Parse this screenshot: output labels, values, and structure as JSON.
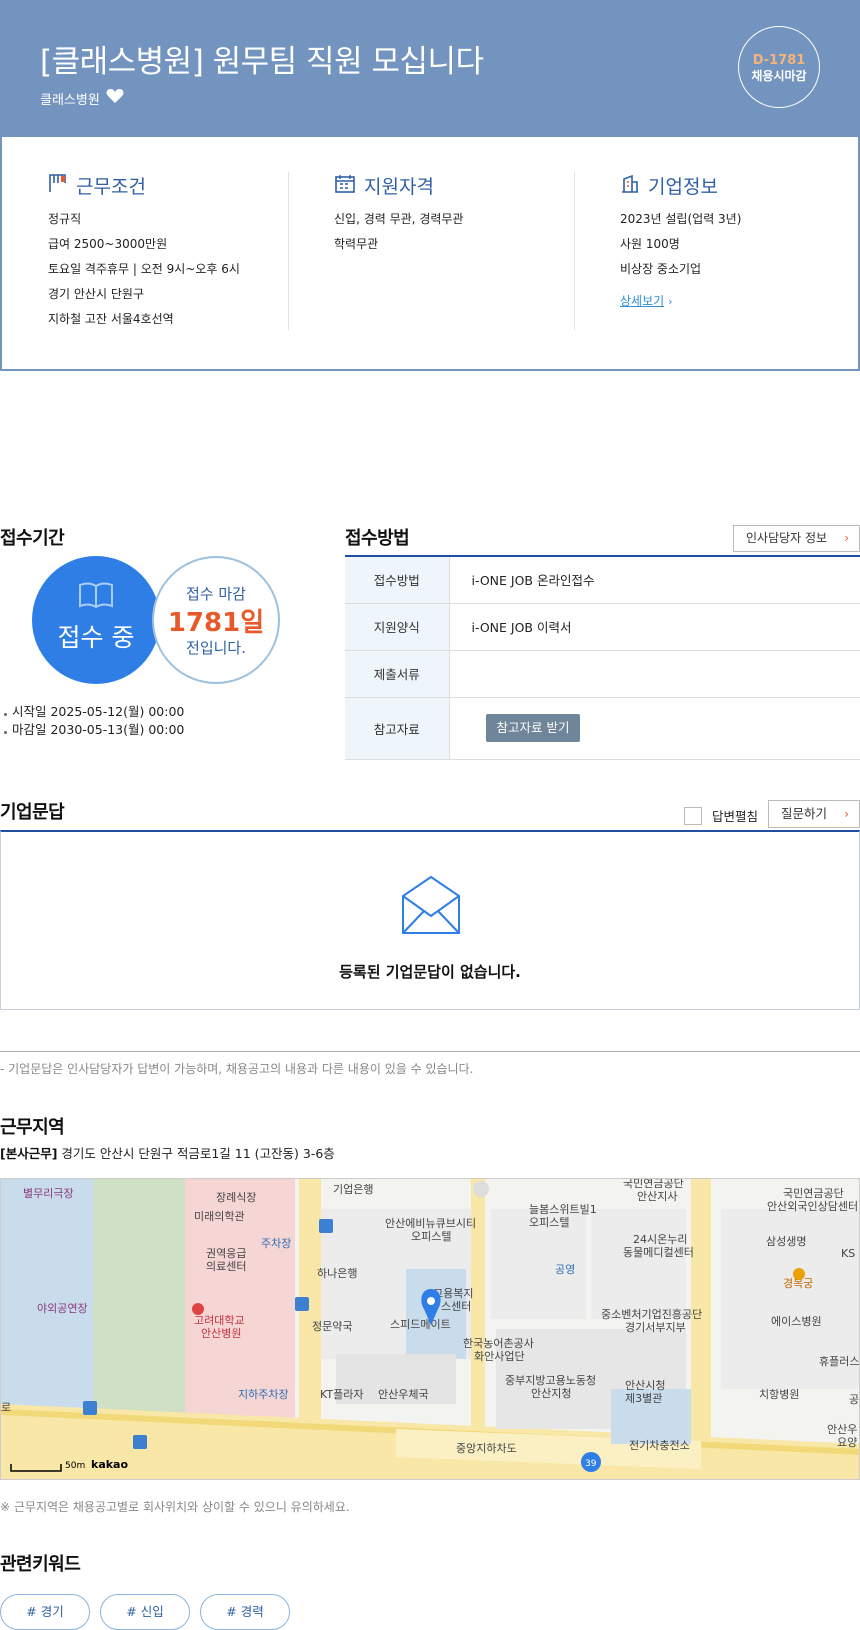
{
  "header": {
    "title": "[클래스병원] 원무팀 직원 모십니다",
    "company": "클래스병원",
    "dday": "D-1781",
    "deadline_type": "채용시마감"
  },
  "conditions": {
    "title": "근무조건",
    "items": [
      "정규직",
      "급여 2500~3000만원",
      "토요일 격주휴무 | 오전 9시~오후 6시",
      "경기 안산시 단원구",
      "지하철 고잔 서울4호선역"
    ]
  },
  "qualifications": {
    "title": "지원자격",
    "items": [
      "신입, 경력 무관, 경력무관",
      "학력무관"
    ]
  },
  "company_info": {
    "title": "기업정보",
    "items": [
      "2023년 설립(업력 3년)",
      "사원 100명",
      "비상장 중소기업"
    ],
    "more": "상세보기"
  },
  "period": {
    "title": "접수기간",
    "status": "접수 중",
    "deadline_label": "접수 마감",
    "days_left": "1781일",
    "suffix": "전입니다.",
    "start": "시작일 2025-05-12(월) 00:00",
    "end": "마감일 2030-05-13(월) 00:00"
  },
  "method": {
    "title": "접수방법",
    "hr_button": "인사담당자 정보",
    "rows": [
      {
        "key": "접수방법",
        "value": "i-ONE JOB 온라인접수"
      },
      {
        "key": "지원양식",
        "value": "i-ONE JOB 이력서"
      },
      {
        "key": "제출서류",
        "value": ""
      },
      {
        "key": "참고자료",
        "value": ""
      }
    ],
    "ref_button": "참고자료 받기"
  },
  "qa": {
    "title": "기업문답",
    "expand_label": "답변펼침",
    "ask_button": "질문하기",
    "empty_message": "등록된 기업문답이 없습니다.",
    "note": "- 기업문답은 인사담당자가 답변이 가능하며, 채용공고의 내용과 다른 내용이 있을 수 있습니다."
  },
  "location": {
    "title": "근무지역",
    "tag": "[본사근무]",
    "address": "경기도 안산시 단원구 적금로1길 11 (고잔동) 3-6층",
    "note": "※ 근무지역은 채용공고별로 회사위치와 상이할 수 있으니 유의하세요.",
    "map": {
      "labels": [
        "별무리극장",
        "장례식장",
        "미래의학관",
        "기업은행",
        "국민연금공단 안산지사",
        "국민연금공단 안산외국인상담센터",
        "안산에비뉴큐브시티 오피스텔",
        "늘봄스위트빌1 오피스텔",
        "권역응급 의료센터",
        "주차장",
        "하나은행",
        "24시온누리 동물메디컬센터",
        "삼성생명",
        "경복궁",
        "야외공연장",
        "고려대학교 안산병원",
        "고용복지 플러스센터",
        "스피드메이트",
        "정문약국",
        "공영",
        "중소벤처기업진흥공단 경기서부지부",
        "에이스병원",
        "한국농어촌공사 화안사업단",
        "중부지방고용노동청 안산지청",
        "안산시청 제3별관",
        "지하주차장",
        "KT플라자",
        "안산우체국",
        "치항병원",
        "휴플러스",
        "중앙지하차도",
        "전기차충전소",
        "KS",
        "공",
        "안산우 요양",
        "로"
      ],
      "scale": "50m",
      "brand": "kakao",
      "route": "39"
    }
  },
  "keywords": {
    "title": "관련키워드",
    "items": [
      "# 경기",
      "# 신입",
      "# 경력"
    ]
  },
  "colors": {
    "header_bg": "#7294bf",
    "accent_blue": "#2e7ee6",
    "accent_orange": "#e8592a",
    "table_key_bg": "#eef5fb"
  }
}
